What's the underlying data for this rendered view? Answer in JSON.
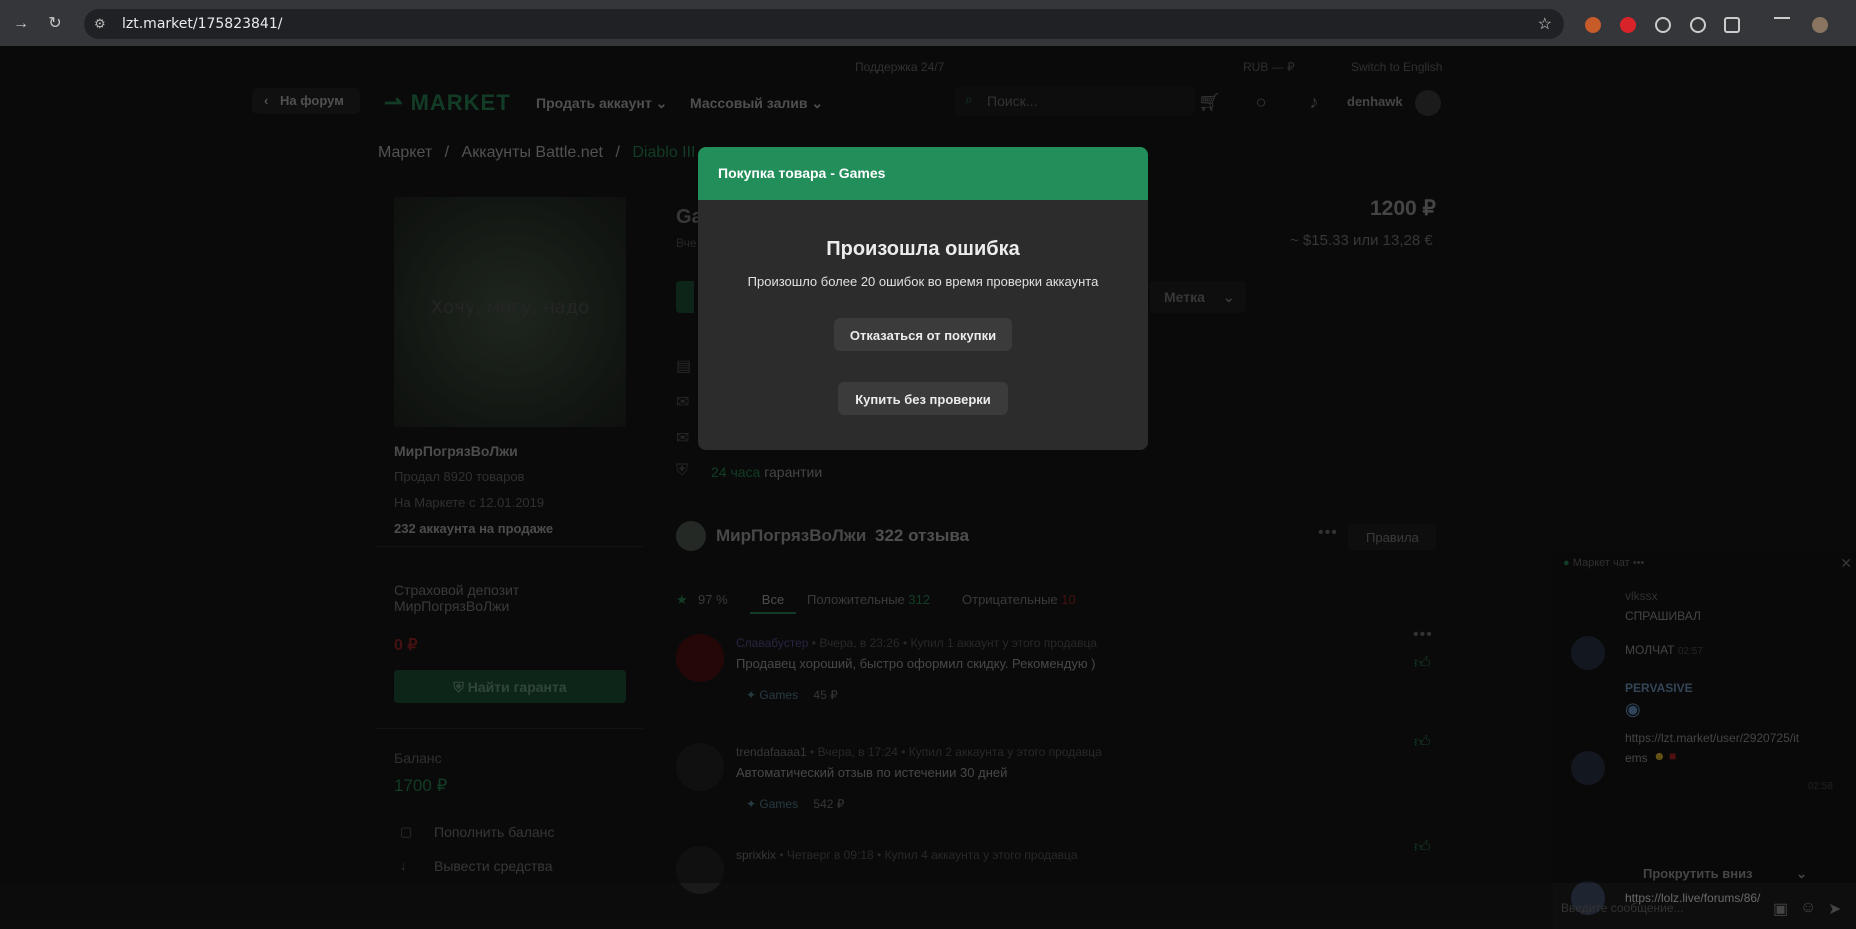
{
  "browser": {
    "url": "lzt.market/175823841/"
  },
  "topstrip": {
    "support": "Поддержка 24/7",
    "currency": "RUB — ₽",
    "lang": "Switch to English"
  },
  "header": {
    "forum_btn": "На форум",
    "logo": "MARKET",
    "nav_sell": "Продать аккаунт",
    "nav_mass": "Массовый залив",
    "search_placeholder": "Поиск...",
    "username": "denhawk"
  },
  "breadcrumb": {
    "item1": "Маркет",
    "sep": "/",
    "item2": "Аккаунты Battle.net",
    "item3": "Diablo III"
  },
  "seller": {
    "image_text": "Хочу, могу, надо",
    "name": "МирПогрязВоЛжи",
    "sold": "Продал 8920 товаров",
    "since": "На Маркете с 12.01.2019",
    "on_sale": "232 аккаунта на продаже",
    "deposit_label": "Страховой депозит МирПогрязВоЛжи",
    "deposit_value": "0 ₽",
    "find_guarantor": "Найти гаранта",
    "balance_label": "Баланс",
    "balance_value": "1700 ₽",
    "topup": "Пополнить баланс",
    "withdraw": "Вывести средства"
  },
  "product": {
    "title_partial": "Ga",
    "subtitle_partial": "Вче",
    "price": "1200 ₽",
    "price_alt": "~ $15.33 или 13,28 €",
    "tag_btn": "Метка",
    "guarantee_hours": "24 часа",
    "guarantee_text": "гарантии"
  },
  "reviews": {
    "seller": "МирПогрязВоЛжи",
    "count": "322 отзыва",
    "rules_btn": "Правила",
    "percent": "97 %",
    "tab_all": "Все",
    "tab_positive": "Положительные",
    "positive_count": "312",
    "tab_negative": "Отрицательные",
    "negative_count": "10",
    "items": [
      {
        "name": "Славабустер",
        "meta": "• Вчера, в 23:26 • Купил 1 аккаунт у этого продавца",
        "text": "Продавец хороший, быстро оформил скидку. Рекомендую )",
        "game": "Games",
        "amount": "45 ₽"
      },
      {
        "name": "trendafaaaa1",
        "meta": "• Вчера, в 17:24 • Купил 2 аккаунта у этого продавца",
        "text": "Автоматический отзыв по истечении 30 дней",
        "game": "Games",
        "amount": "542 ₽"
      },
      {
        "name": "sprixkix",
        "meta": "• Четверг в 09:18 • Купил 4 аккаунта у этого продавца",
        "text": "",
        "game": "",
        "amount": ""
      }
    ]
  },
  "chat": {
    "title": "Маркет чат",
    "msg1_user": "vlkssx",
    "msg1": "СПРАШИВАЛ",
    "msg2": "МОЛЧАТ",
    "msg2_time": "02:57",
    "msg3_user": "PERVASIVE",
    "msg3_link1": "https://lzt.market/user/2920725/it",
    "msg3_link2": "ems",
    "msg3_time": "02:58",
    "scroll_down": "Прокрутить вниз",
    "msg4": "https://lolz.live/forums/86/",
    "input_placeholder": "Введите сообщение..."
  },
  "modal": {
    "header": "Покупка товара - Games",
    "title": "Произошла ошибка",
    "message": "Произошло более 20 ошибок во время проверки аккаунта",
    "decline_btn": "Отказаться от покупки",
    "buy_btn": "Купить без проверки"
  },
  "colors": {
    "accent": "#228e5a",
    "modal_bg": "#2c2c2c",
    "page_bg": "#101010"
  }
}
